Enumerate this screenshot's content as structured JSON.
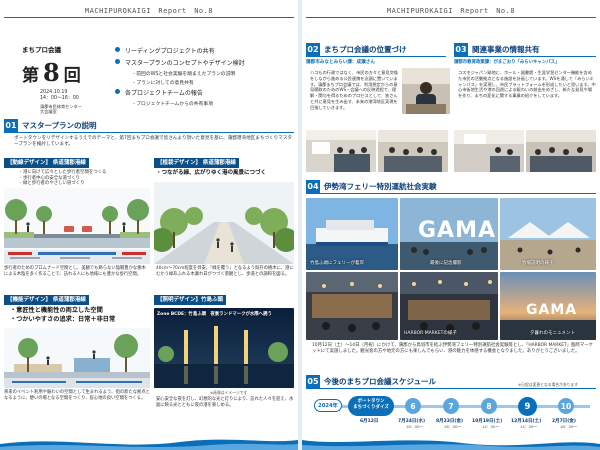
{
  "header": {
    "left": "MACHIPUROKAIGI　Report　No.8",
    "right": "MACHIPUROKAIGI　Report　No.8"
  },
  "cover": {
    "kaigi": "まちプロ会議",
    "dai": "第",
    "num": "8",
    "kai": "回",
    "date": "2024.10.19",
    "time": "14：00～16：00",
    "venue1": "蒲郡市民体育センター",
    "venue2": "大会議室"
  },
  "agenda": [
    {
      "label": "リーディングプロジェクトの共有",
      "subs": []
    },
    {
      "label": "マスタープランのコンセプトやデザイン検討",
      "subs": [
        "- 前回のWSと社会実験を踏まえたプランの説明",
        "- プランに対しての意見共有"
      ]
    },
    {
      "label": "各プロジェクトチームの報告",
      "subs": [
        "- プロジェクトチームからの共有事項"
      ]
    }
  ],
  "s01": {
    "num": "01",
    "title": "マスタープランの説明",
    "intro": "ポートタウンをリデザインするうえでのテーマと、第7回まちプロ会議で皆さんより頂いた意見を基に、蒲郡港湾地区まちづくりマスタープランを検討しています。",
    "b1": {
      "badge": "【動線デザイン】 県道蒲郡港線",
      "l1": "- 港に向けて広々とした歩行者空間をつくる",
      "l2": "- 歩行者中心の安全な道づくり",
      "l3": "- 緑と歩行者のやさしい道づくり",
      "body": "歩行者のためのプロムナード空間とし、美観でも飾らない陰翳豊かな樹木による木陰を多く作ることで、訪れる人にも地域にも豊かな歩行空間。"
    },
    "b2": {
      "badge": "【植栽デザイン】 県道蒲郡港線",
      "h": "・つながる緑、広がりゆく港の風景につづく",
      "body": "40cm～70cm程度を目安。「緑を覆う」となるよう既存の樹木に、港にむかう緑あふれる木漏れ日がつづく景観とし、歩道との調和を図る。"
    },
    "b3": {
      "badge": "【機能デザイン】 県道蒲郡港線",
      "h1": "・意匠性と機能性の両立した空間",
      "h2": "・つかいやすさの追求：日常＋非日常",
      "body": "将来のイベント利用や賑わいの空間として生まれるよう、街の新たな拠点となるように、憩いの場となる空間をつくり、居心地の良い空間をつくる。"
    },
    "b4": {
      "badge": "【照明デザイン】竹島ふ頭",
      "panel": "Zone BCDE：竹島ふ頭　夜景ランドマークが水際へ誘う",
      "body": "安心安全な夜を灯し、幻想的な光と灯りにより、訪れた人々を迎え、水面に映る光とともに夜の港を楽しめる。",
      "cap": "※画像はイメージです"
    }
  },
  "s02": {
    "num": "02",
    "title": "まちプロ会議の位置づけ",
    "lead": "蒲郡市みなとみらい課：成瀬さん",
    "body": "ハコもの行政ではなく、市民の方々と意見交換をしながら進める公民連携を念頭に置いています。蒲郡まちプロ会議では、利用想定からの意見聴取のためのWS・会議への反映過程で、理解・関与を得るためのプロセスとして、皆さんと共に意見を生み出す、未来の港湾地区実現を目指していきます。"
  },
  "s03": {
    "num": "03",
    "title": "関連事業の情報共有",
    "lead": "蒲郡市教育政策課：がまごおり「みらいキャンパス」",
    "body": "コスモジャパン跡地に、ホール・図書館・生涯学習センター機能を含めた市民の活動拠点となる施設を計画しています。WSを通して「みらいキャンパス」を実現し、市民ブラットフォームを形成したいと思います。中心市街地生活や港の回遊による賑わいの創出をめざし、新たな発見や場を作り、まちの変化に関する事業の紹介をしています。"
  },
  "s04": {
    "num": "04",
    "title": "伊勢湾フェリー特別運航社会実験",
    "photos": [
      "竹島ふ頭にフェリーが着岸",
      "最後に記念撮影",
      "会場説明の様子",
      "HARBOR MARKETの様子",
      "夕暮れのモニュメント"
    ],
    "gama": "GAMA",
    "body": "10月12日（土）～14日（月祝）にかけて、蒲郡から鳥羽市を結ぶ伊勢湾フェリー特別運航社会実験等とし、「HARBOR MARKET」臨時マーケットにて実施しました。観光客の方や地元の方にも楽しんでもらい、港の魅力を体感する機会となりました。ありがとうございました。"
  },
  "s05": {
    "num": "05",
    "title": "今後のまちプロ会議スケジュール",
    "note": "※日程は変更となる場合があります",
    "year": "2024年",
    "start_l1": "ポートタウン",
    "start_l2": "まちづくりダイズ",
    "start_date": "6月12日",
    "items": [
      {
        "n": "6",
        "d": "7月24日(水)",
        "t": "18：00～"
      },
      {
        "n": "7",
        "d": "8月23日(金)",
        "t": "18：00～"
      },
      {
        "n": "8",
        "d": "10月19日(土)",
        "t": "14：00～"
      },
      {
        "n": "9",
        "d": "12月14日(土)",
        "t": "14：00～"
      },
      {
        "n": "10",
        "d": "2月7日(金)",
        "t": "18：00～"
      }
    ]
  }
}
